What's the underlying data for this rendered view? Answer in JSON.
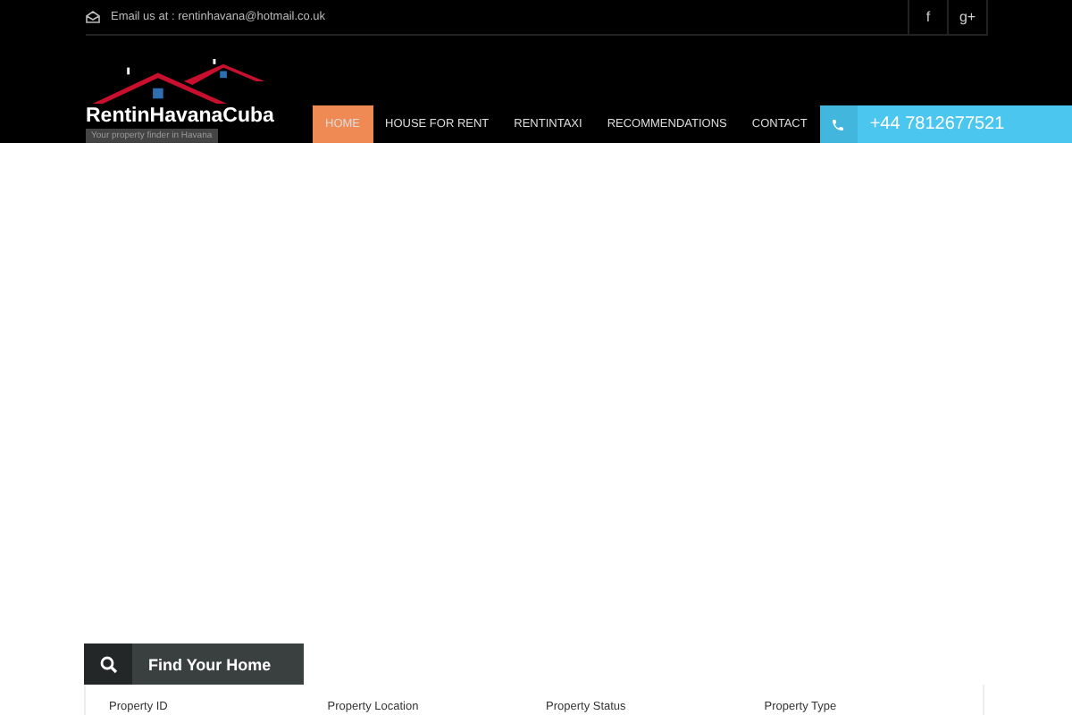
{
  "topbar": {
    "email": "Email us at : rentinhavana@hotmail.co.uk",
    "social": [
      "f",
      "g+"
    ]
  },
  "logo": {
    "name": "RentinHavanaCuba",
    "tagline": "Your property finder in Havana"
  },
  "nav": [
    {
      "label": "HOME",
      "selected": true
    },
    {
      "label": "HOUSE FOR RENT",
      "selected": false
    },
    {
      "label": "RENTINTAXI",
      "selected": false
    },
    {
      "label": "RECOMMENDATIONS",
      "selected": false
    },
    {
      "label": "CONTACT",
      "selected": false
    }
  ],
  "phone": "+44 7812677521",
  "search": {
    "title": "Find Your Home",
    "fields": [
      "Property ID",
      "Property Location",
      "Property Status",
      "Property Type"
    ]
  }
}
